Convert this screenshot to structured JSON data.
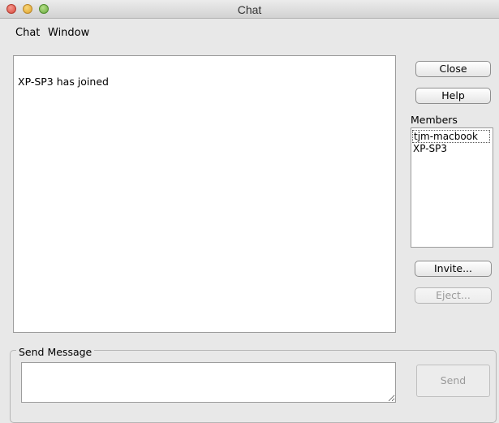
{
  "window": {
    "title": "Chat"
  },
  "menu": {
    "items": [
      "Chat",
      "Window"
    ]
  },
  "chat_log": {
    "lines": [
      "XP-SP3 has joined"
    ]
  },
  "buttons": {
    "close": "Close",
    "help": "Help",
    "invite": "Invite...",
    "eject": "Eject...",
    "send": "Send"
  },
  "members": {
    "label": "Members",
    "items": [
      "tjm-macbook",
      "XP-SP3"
    ],
    "selected": "tjm-macbook"
  },
  "send_message": {
    "label": "Send Message",
    "value": ""
  }
}
